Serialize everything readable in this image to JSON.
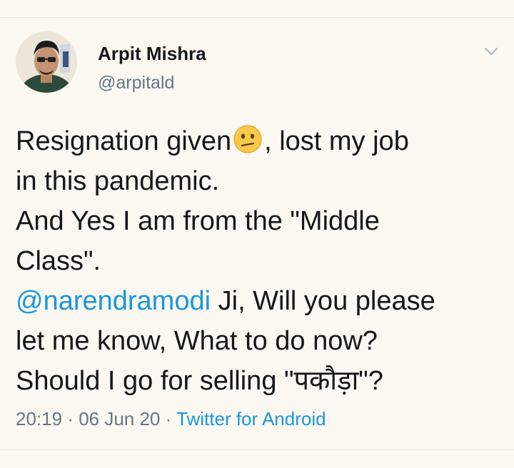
{
  "author": {
    "name": "Arpit Mishra",
    "handle": "@arpitald"
  },
  "tweet": {
    "line1_a": "Resignation given",
    "emoji": "confused-face-emoji",
    "line1_b": ", lost my job",
    "line2": "in this pandemic.",
    "line3": "And Yes I am from the \"Middle",
    "line4": "Class\".",
    "mention": "@narendramodi",
    "line5_rest": " Ji, Will you please",
    "line6": "let me know, What to do now?",
    "line7": "Should I go for selling \"पकौड़ा\"?"
  },
  "meta": {
    "time": "20:19",
    "sep1": " · ",
    "date": "06 Jun 20",
    "sep2": " · ",
    "source": "Twitter for Android"
  },
  "icons": {
    "menu": "chevron-down-icon",
    "avatar": "avatar"
  },
  "colors": {
    "background": "#fbf9f1",
    "text": "#14171a",
    "secondary": "#657786",
    "link": "#1b95e0"
  }
}
